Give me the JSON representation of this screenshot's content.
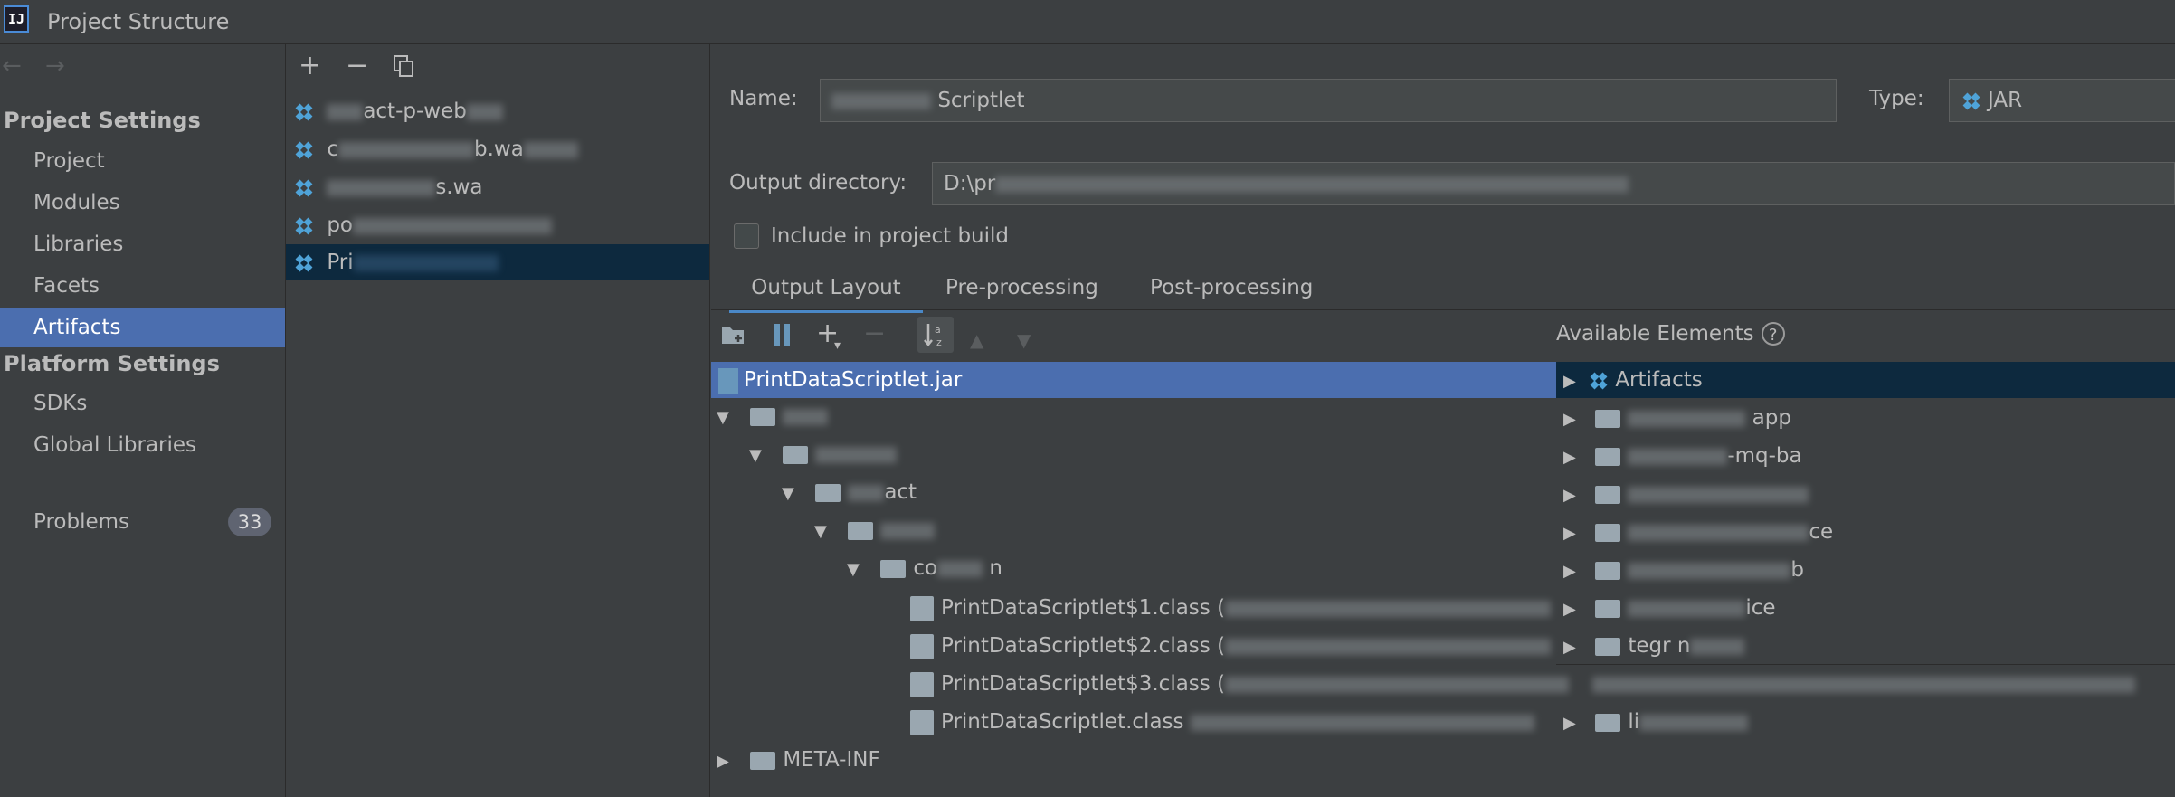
{
  "window": {
    "title": "Project Structure",
    "app_icon": "IJ"
  },
  "nav": {
    "back_icon": "arrow-left-icon",
    "forward_icon": "arrow-right-icon",
    "project_settings_heading": "Project Settings",
    "project_settings_items": [
      "Project",
      "Modules",
      "Libraries",
      "Facets",
      "Artifacts"
    ],
    "selected_item": "Artifacts",
    "platform_settings_heading": "Platform Settings",
    "platform_settings_items": [
      "SDKs",
      "Global Libraries"
    ],
    "problems_label": "Problems",
    "problems_count": "33"
  },
  "artifacts_list": {
    "toolbar": {
      "add": "+",
      "remove": "−",
      "copy_icon": "copy-icon"
    },
    "items": [
      {
        "prefix": "",
        "suffix": "act-p-web"
      },
      {
        "prefix": "c",
        "suffix": "b.wa"
      },
      {
        "prefix": "",
        "suffix": "s.wa"
      },
      {
        "prefix": "po",
        "suffix": ""
      },
      {
        "prefix": "Pri",
        "suffix": ""
      }
    ],
    "selected_index": 4
  },
  "editor": {
    "name_label": "Name:",
    "name_value": "Scriptlet",
    "type_label": "Type:",
    "type_value": "JAR",
    "output_dir_label": "Output directory:",
    "output_dir_value": "D:\\pr",
    "include_label": "Include in project build",
    "include_checked": false,
    "tabs": [
      "Output Layout",
      "Pre-processing",
      "Post-processing"
    ],
    "active_tab": "Output Layout"
  },
  "layout_toolbar": {
    "icons": [
      "new-folder-icon",
      "archive-icon",
      "add-icon",
      "remove-icon",
      "sort-icon",
      "move-up-icon",
      "move-down-icon"
    ],
    "add": "+",
    "remove": "−"
  },
  "layout_tree": {
    "root": "PrintDataScriptlet.jar",
    "folder_3_label": "act",
    "folder_5_label": "co",
    "folder_5_suffix": "n",
    "classes": [
      "PrintDataScriptlet$1.class",
      "PrintDataScriptlet$2.class",
      "PrintDataScriptlet$3.class",
      "PrintDataScriptlet.class"
    ],
    "class_suffixes": [
      "(",
      "(",
      "(",
      ""
    ],
    "meta_inf": "META-INF"
  },
  "available_elements": {
    "title": "Available Elements",
    "help_icon": "?",
    "artifacts_label": "Artifacts",
    "rows": [
      "app",
      "-mq-ba",
      "",
      "ce",
      "b",
      "ice",
      "tegr n",
      "",
      "li"
    ]
  }
}
